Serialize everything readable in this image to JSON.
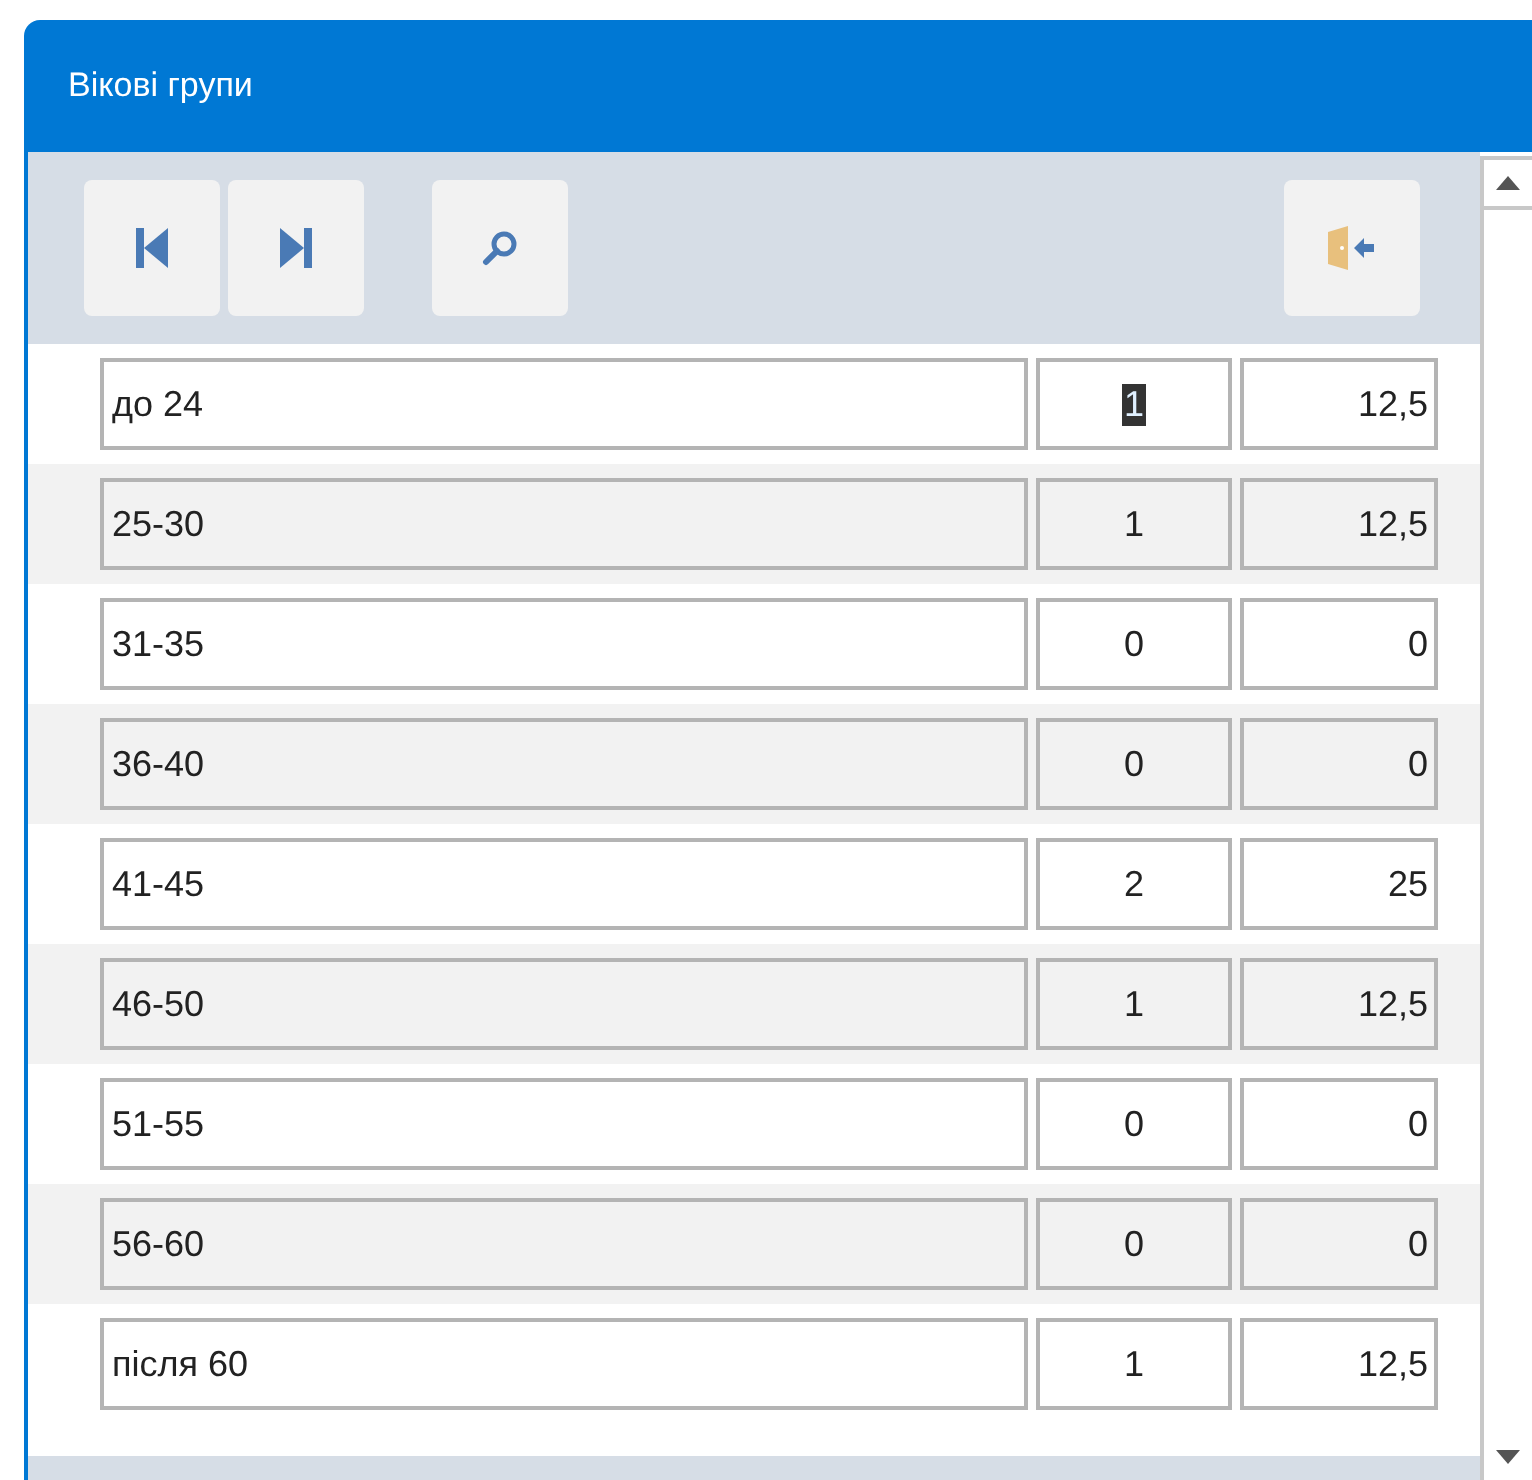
{
  "window": {
    "title": "Вікові групи"
  },
  "toolbar": [
    {
      "kind": "first"
    },
    {
      "kind": "last"
    },
    {
      "kind": "search"
    },
    {
      "kind": "exit"
    }
  ],
  "rows": [
    {
      "group": "до 24",
      "count": "1",
      "percent": "12,5",
      "focused": true
    },
    {
      "group": "25-30",
      "count": "1",
      "percent": "12,5",
      "focused": false
    },
    {
      "group": "31-35",
      "count": "0",
      "percent": "0",
      "focused": false
    },
    {
      "group": "36-40",
      "count": "0",
      "percent": "0",
      "focused": false
    },
    {
      "group": "41-45",
      "count": "2",
      "percent": "25",
      "focused": false
    },
    {
      "group": "46-50",
      "count": "1",
      "percent": "12,5",
      "focused": false
    },
    {
      "group": "51-55",
      "count": "0",
      "percent": "0",
      "focused": false
    },
    {
      "group": "56-60",
      "count": "0",
      "percent": "0",
      "focused": false
    },
    {
      "group": "після 60",
      "count": "1",
      "percent": "12,5",
      "focused": false
    }
  ]
}
